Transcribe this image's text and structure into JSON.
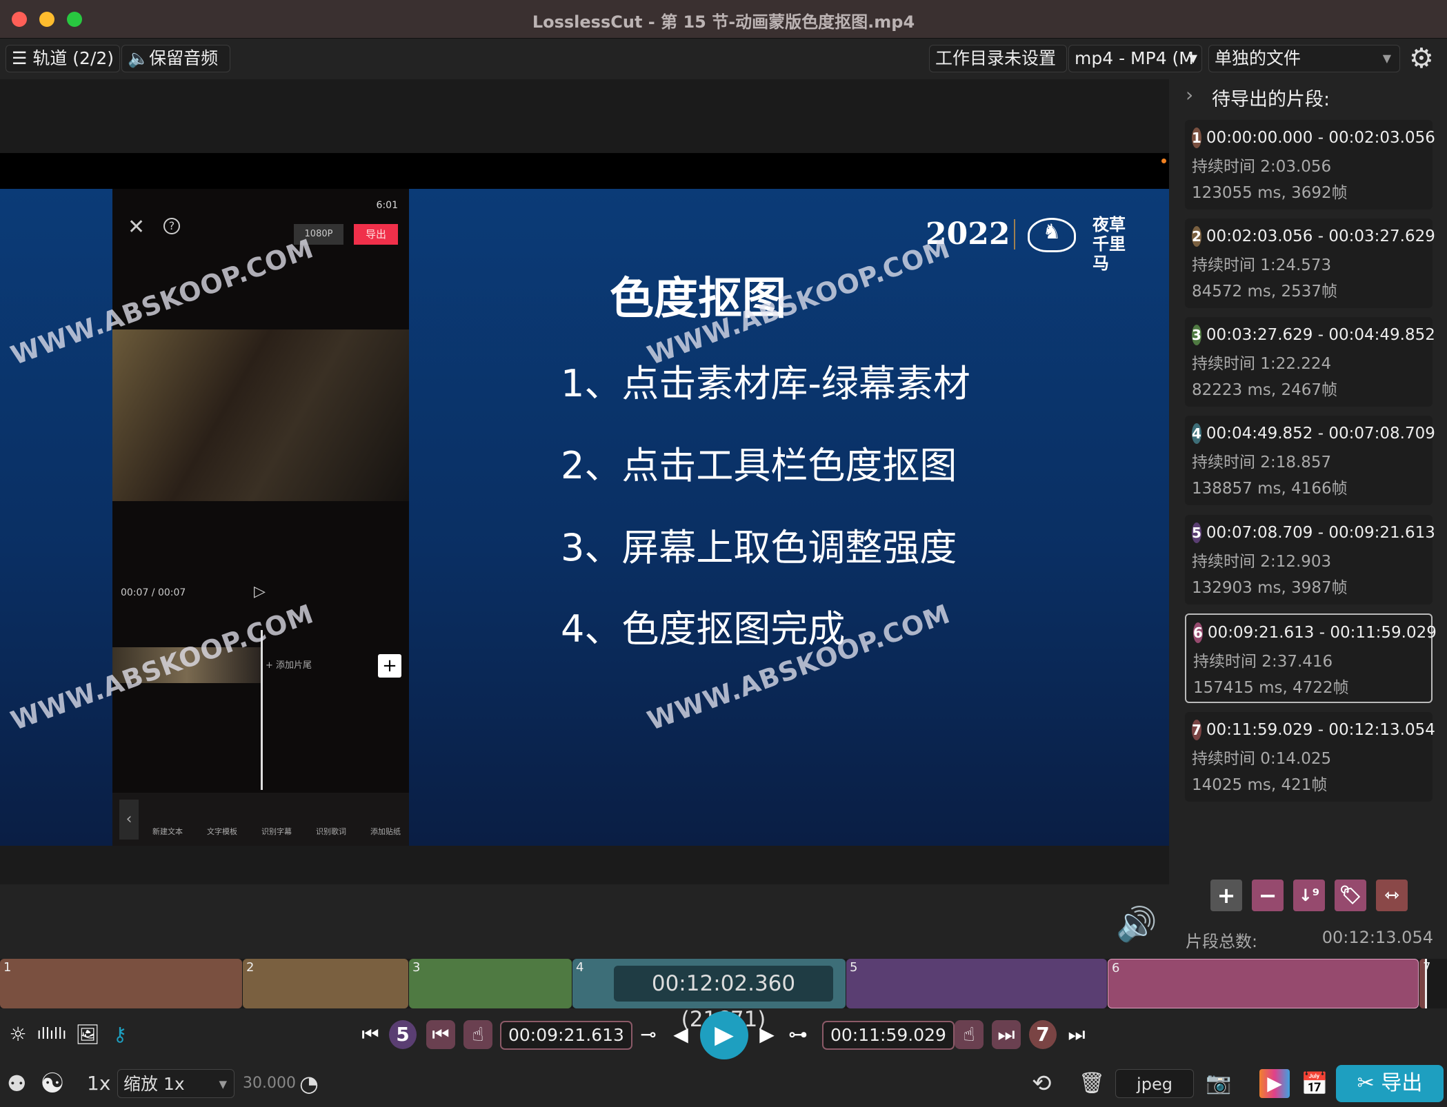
{
  "window": {
    "title": "LosslessCut - 第 15 节-动画蒙版色度抠图.mp4"
  },
  "toolbar": {
    "tracks": "轨道 (2/2)",
    "keep_audio": "保留音频",
    "workdir": "工作目录未设置",
    "format": "mp4 - MP4 (M",
    "output_mode": "单独的文件"
  },
  "video": {
    "watermark": "WWW.ABSKOOP.COM",
    "slide": {
      "year": "2022",
      "logo_text": "夜草千里马",
      "title": "色度抠图",
      "items": [
        "1、点击素材库-绿幕素材",
        "2、点击工具栏色度抠图",
        "3、屏幕上取色调整强度",
        "4、色度抠图完成"
      ]
    },
    "phone": {
      "clock": "6:01",
      "resolution": "1080P",
      "export": "导出",
      "time": "00:07 / 00:07",
      "add_clip": "+ 添加片尾",
      "tools": [
        "新建文本",
        "文字模板",
        "识别字幕",
        "识别歌词",
        "添加贴纸"
      ]
    }
  },
  "panel": {
    "header": "待导出的片段:",
    "total_label": "片段总数:",
    "total_value": "00:12:13.054",
    "segments": [
      {
        "n": "1",
        "range": "00:00:00.000 - 00:02:03.056",
        "duration": "持续时间 2:03.056",
        "frames": "123055 ms, 3692帧",
        "color": "#7a5040"
      },
      {
        "n": "2",
        "range": "00:02:03.056 - 00:03:27.629",
        "duration": "持续时间 1:24.573",
        "frames": "84572 ms, 2537帧",
        "color": "#7a6040"
      },
      {
        "n": "3",
        "range": "00:03:27.629 - 00:04:49.852",
        "duration": "持续时间 1:22.224",
        "frames": "82223 ms, 2467帧",
        "color": "#4f7a42"
      },
      {
        "n": "4",
        "range": "00:04:49.852 - 00:07:08.709",
        "duration": "持续时间 2:18.857",
        "frames": "138857 ms, 4166帧",
        "color": "#3d6e78"
      },
      {
        "n": "5",
        "range": "00:07:08.709 - 00:09:21.613",
        "duration": "持续时间 2:12.903",
        "frames": "132903 ms, 3987帧",
        "color": "#5a3e72"
      },
      {
        "n": "6",
        "range": "00:09:21.613 - 00:11:59.029",
        "duration": "持续时间 2:37.416",
        "frames": "157415 ms, 4722帧",
        "color": "#964a6e",
        "selected": true
      },
      {
        "n": "7",
        "range": "00:11:59.029 - 00:12:13.054",
        "duration": "持续时间 0:14.025",
        "frames": "14025 ms, 421帧",
        "color": "#7a4444"
      }
    ]
  },
  "timeline": {
    "current": "00:12:02.360 (21671)"
  },
  "controls": {
    "seg_start_num": "5",
    "start_time": "00:09:21.613",
    "end_time": "00:11:59.029",
    "seg_end_num": "7"
  },
  "bottom": {
    "speed": "1x",
    "zoom": "缩放 1x",
    "fps": "30.000",
    "capture_format": "jpeg",
    "export": "导出"
  },
  "colors": {
    "accent": "#1e9fc0",
    "segment_border": "#8c5a68"
  }
}
